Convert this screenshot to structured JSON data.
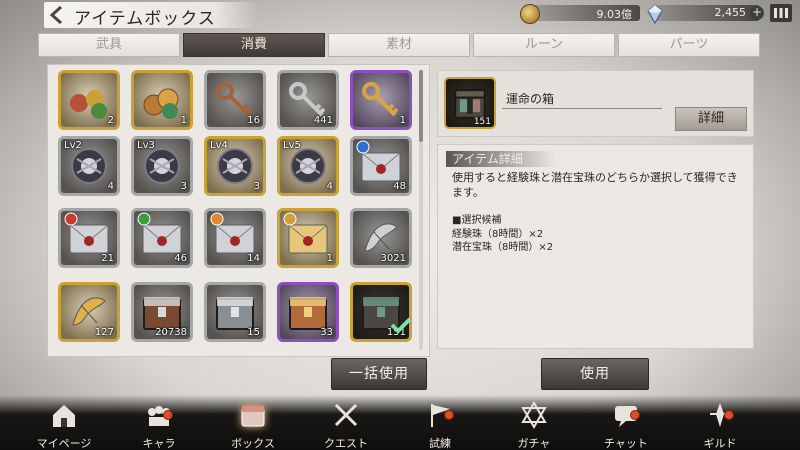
{
  "header": {
    "title": "アイテムボックス",
    "currency_gold": "9.03億",
    "currency_gem": "2,455",
    "plus_label": "+"
  },
  "tabs": [
    {
      "label": "武具",
      "active": false
    },
    {
      "label": "消費",
      "active": true
    },
    {
      "label": "素材",
      "active": false
    },
    {
      "label": "ルーン",
      "active": false
    },
    {
      "label": "パーツ",
      "active": false
    }
  ],
  "inventory": {
    "items": [
      {
        "kind": "orbs",
        "frame": "gold",
        "count": "2"
      },
      {
        "kind": "coins",
        "frame": "gold",
        "count": "1"
      },
      {
        "kind": "key-bronze",
        "frame": "silver",
        "count": "16"
      },
      {
        "kind": "key-silver",
        "frame": "silver",
        "count": "441"
      },
      {
        "kind": "key-gold",
        "frame": "purple",
        "count": "1"
      },
      {
        "kind": "emblem",
        "frame": "silver",
        "level": "Lv2",
        "count": "4"
      },
      {
        "kind": "emblem",
        "frame": "silver",
        "level": "Lv3",
        "count": "3"
      },
      {
        "kind": "emblem",
        "frame": "gold",
        "level": "Lv4",
        "count": "3"
      },
      {
        "kind": "emblem",
        "frame": "gold",
        "level": "Lv5",
        "count": "4"
      },
      {
        "kind": "letter-blue",
        "frame": "silver",
        "count": "48"
      },
      {
        "kind": "letter-red",
        "frame": "silver",
        "count": "21"
      },
      {
        "kind": "letter-green",
        "frame": "silver",
        "count": "46"
      },
      {
        "kind": "letter-orange",
        "frame": "silver",
        "count": "14"
      },
      {
        "kind": "letter-gold",
        "frame": "gold",
        "count": "1"
      },
      {
        "kind": "scroll-silver",
        "frame": "silver",
        "count": "3021"
      },
      {
        "kind": "scroll-gold",
        "frame": "gold",
        "count": "127"
      },
      {
        "kind": "chest-bronze",
        "frame": "silver",
        "count": "20738"
      },
      {
        "kind": "chest-silver",
        "frame": "silver",
        "count": "15"
      },
      {
        "kind": "chest-ornate",
        "frame": "purple",
        "count": "33"
      },
      {
        "kind": "chest-fate",
        "frame": "selected",
        "count": "151"
      }
    ],
    "bulk_use_label": "一括使用",
    "use_label": "使用"
  },
  "detail": {
    "item_name": "運命の箱",
    "item_count": "151",
    "detail_button": "詳細",
    "section_title": "アイテム詳細",
    "description": "使用すると経験珠と潜在宝珠のどちらか選択して獲得できます。",
    "candidates_title": "■選択候補",
    "candidates": [
      "経験珠（8時間）×2",
      "潜在宝珠（8時間）×2"
    ]
  },
  "nav": [
    {
      "label": "マイページ",
      "icon": "house-icon",
      "badge": false,
      "active": false
    },
    {
      "label": "キャラ",
      "icon": "characters-icon",
      "badge": true,
      "active": false
    },
    {
      "label": "ボックス",
      "icon": "box-icon",
      "badge": false,
      "active": true
    },
    {
      "label": "クエスト",
      "icon": "swords-icon",
      "badge": false,
      "active": false
    },
    {
      "label": "試練",
      "icon": "flag-icon",
      "badge": true,
      "active": false
    },
    {
      "label": "ガチャ",
      "icon": "hexagram-icon",
      "badge": false,
      "active": false
    },
    {
      "label": "チャット",
      "icon": "chat-icon",
      "badge": true,
      "active": false
    },
    {
      "label": "ギルド",
      "icon": "guild-icon",
      "badge": true,
      "active": false
    }
  ],
  "colors": {
    "accent_gold": "#c9a235",
    "accent_purple": "#8c4fc0",
    "badge_red": "#e24a2a",
    "dark_button": "#3c3733"
  }
}
